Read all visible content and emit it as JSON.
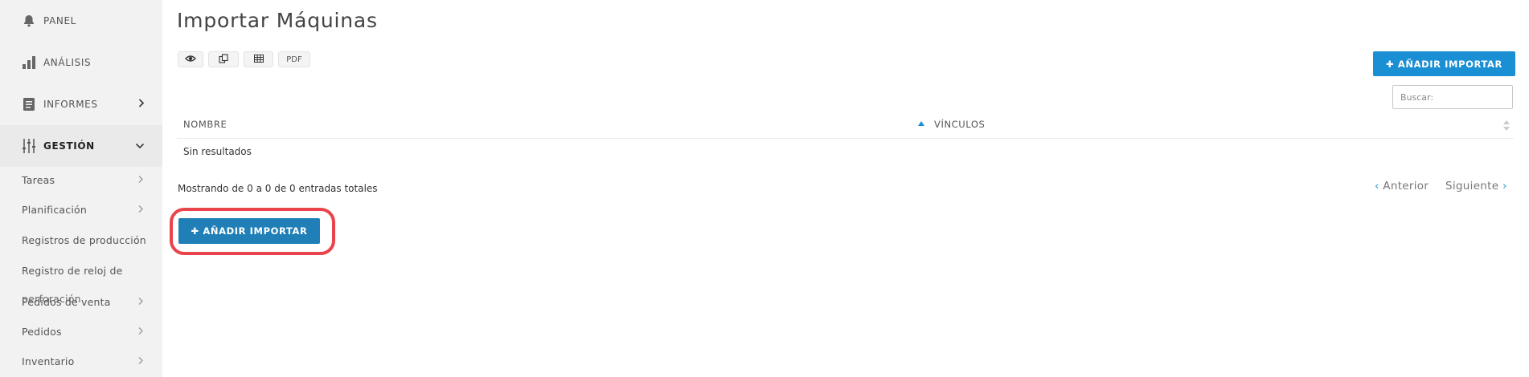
{
  "sidebar": {
    "items": [
      {
        "label": "PANEL",
        "icon": "bell-icon"
      },
      {
        "label": "ANÁLISIS",
        "icon": "bar-chart-icon"
      },
      {
        "label": "INFORMES",
        "icon": "document-icon"
      },
      {
        "label": "GESTIÓN",
        "icon": "sliders-icon"
      }
    ],
    "subitems": [
      "Tareas",
      "Planificación",
      "Registros de producción",
      "Registro de reloj de",
      "Pedidos de venta",
      "Pedidos",
      "Inventario"
    ],
    "overlapping_text": "perforación"
  },
  "page": {
    "title": "Importar Máquinas"
  },
  "toolbar": {
    "pdf_label": "PDF",
    "add_label": "✚ AÑADIR IMPORTAR"
  },
  "search": {
    "placeholder": "Buscar:"
  },
  "table": {
    "columns": [
      "NOMBRE",
      "VÍNCULOS"
    ],
    "empty_text": "Sin resultados",
    "info": "Mostrando de 0 a 0 de 0 entradas totales"
  },
  "pagination": {
    "prev": "Anterior",
    "next": "Siguiente"
  },
  "bottom": {
    "add_label": "✚ AÑADIR IMPORTAR"
  },
  "colors": {
    "accent": "#1a8fd4",
    "highlight": "#e9434b",
    "sidebar_bg": "#f2f2f2"
  }
}
